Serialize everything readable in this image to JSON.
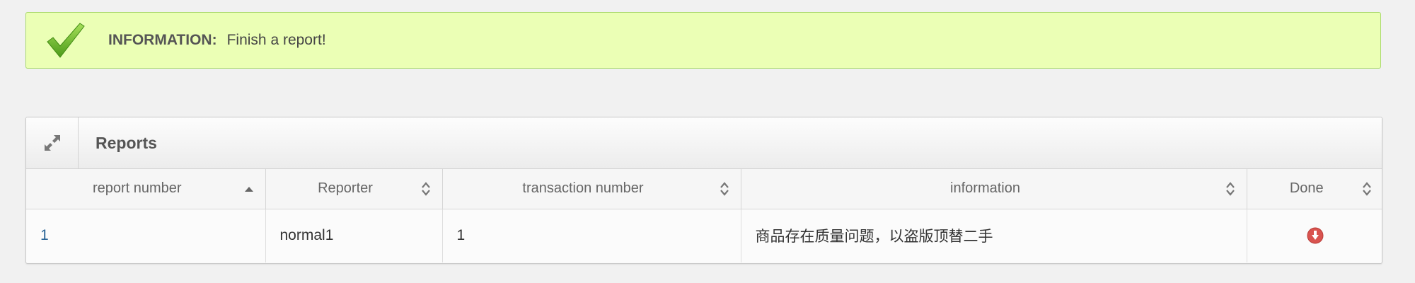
{
  "alert": {
    "title": "INFORMATION:",
    "message": "Finish a report!",
    "icon": "check-icon",
    "background": "#ebffb5",
    "border": "#a9d96c"
  },
  "widget": {
    "title": "Reports",
    "expand_icon": "expand-icon"
  },
  "table": {
    "columns": [
      {
        "label": "report number",
        "sort": "ascending"
      },
      {
        "label": "Reporter",
        "sort": "both"
      },
      {
        "label": "transaction number",
        "sort": "both"
      },
      {
        "label": "information",
        "sort": "both"
      },
      {
        "label": "Done",
        "sort": "both"
      }
    ],
    "rows": [
      {
        "report_number": "1",
        "reporter": "normal1",
        "transaction_number": "1",
        "information": "商品存在质量问题，以盗版顶替二手",
        "done_icon": "arrow-down-circle-icon"
      }
    ]
  },
  "colors": {
    "link": "#2a6496",
    "done_icon": "#d9534f"
  }
}
